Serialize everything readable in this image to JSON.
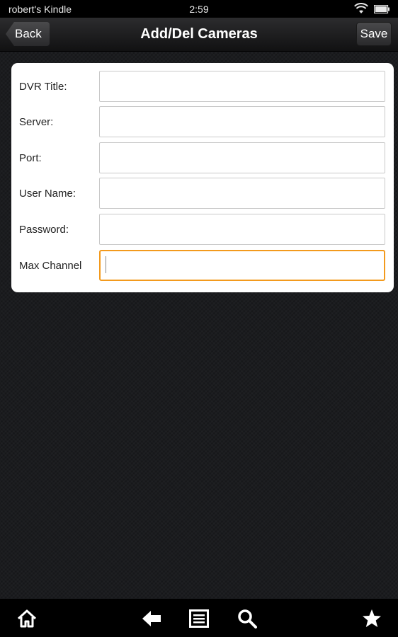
{
  "status_bar": {
    "device_name": "robert's Kindle",
    "time": "2:59",
    "icons": [
      "wifi-icon",
      "battery-icon"
    ]
  },
  "title_bar": {
    "back_label": "Back",
    "title": "Add/Del Cameras",
    "save_label": "Save"
  },
  "form": {
    "fields": [
      {
        "label": "DVR Title:",
        "value": ""
      },
      {
        "label": "Server:",
        "value": ""
      },
      {
        "label": "Port:",
        "value": ""
      },
      {
        "label": "User Name:",
        "value": ""
      },
      {
        "label": "Password:",
        "value": ""
      },
      {
        "label": "Max Channel",
        "value": "",
        "focused": true
      }
    ]
  },
  "nav_bar": {
    "icons": [
      "home-icon",
      "back-arrow-icon",
      "menu-icon",
      "search-icon",
      "favorites-star-icon"
    ]
  },
  "colors": {
    "focus_accent": "#f39a1d",
    "background": "#1a1b1e",
    "card": "#ffffff"
  }
}
